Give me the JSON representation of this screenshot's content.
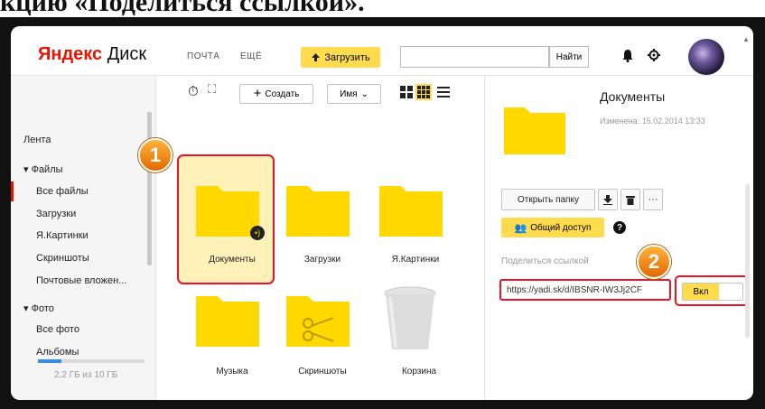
{
  "caption": "кцию «Поделиться ссылкой».",
  "header": {
    "logo_yandex": "Яндекс",
    "logo_disk": "Диск",
    "nav": [
      "ПОЧТА",
      "ЕЩЁ"
    ],
    "upload_label": "Загрузить",
    "search_placeholder": "",
    "find_label": "Найти",
    "icons": [
      "bell-icon",
      "gear-icon",
      "avatar"
    ]
  },
  "sidebar": {
    "items": [
      {
        "label": "Лента"
      },
      {
        "label": "▾ Файлы"
      },
      {
        "label": "Все файлы",
        "active": true
      },
      {
        "label": "Загрузки"
      },
      {
        "label": "Я.Картинки"
      },
      {
        "label": "Скриншоты"
      },
      {
        "label": "Почтовые вложен..."
      },
      {
        "label": "▾ Фото"
      },
      {
        "label": "Все фото"
      },
      {
        "label": "Альбомы"
      }
    ],
    "quota_text": "2,2 ГБ из 10 ГБ",
    "quota_used_fraction": 0.22
  },
  "toolbar": {
    "create_label": "Создать",
    "sort_label": "Имя",
    "view_icons": [
      "tile-large-icon",
      "tile-small-icon",
      "list-icon"
    ]
  },
  "files": [
    {
      "name": "Документы",
      "type": "folder",
      "selected": true,
      "shared": true
    },
    {
      "name": "Загрузки",
      "type": "folder"
    },
    {
      "name": "Я.Картинки",
      "type": "folder"
    },
    {
      "name": "Музыка",
      "type": "folder"
    },
    {
      "name": "Скриншоты",
      "type": "folder-scissors"
    },
    {
      "name": "Корзина",
      "type": "trash"
    }
  ],
  "panel": {
    "title": "Документы",
    "modified": "Изменена: 15.02.2014 13:33",
    "open_folder_label": "Открыть папку",
    "share_access_label": "Общий доступ",
    "share_link_label": "Поделиться ссылкой",
    "share_link_url": "https://yadi.sk/d/IBSNR-IW3Jj2CF",
    "toggle_label": "Вкл"
  },
  "annotations": {
    "step1": "1",
    "step2": "2"
  },
  "colors": {
    "accent_yellow": "#ffdb4d",
    "brand_red": "#e61400",
    "highlight_red": "#e8132a",
    "step_orange": "#f08a10"
  }
}
